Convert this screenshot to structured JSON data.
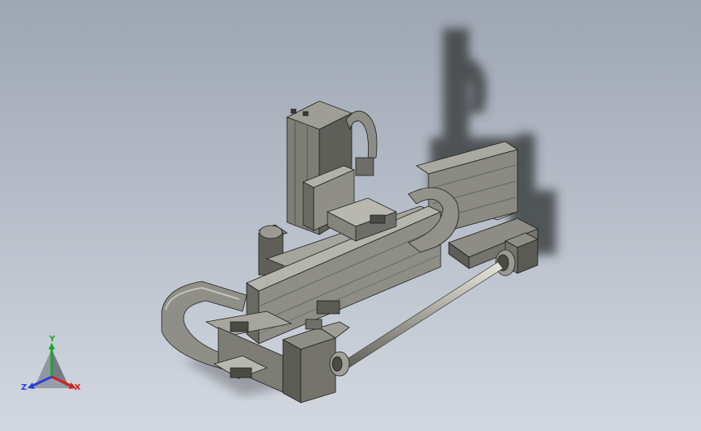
{
  "viewport": {
    "background_top": "#9ea6b3",
    "background_bottom": "#d3d8e0"
  },
  "model": {
    "body_color": "#8d8d86",
    "dark_color": "#3c3c38",
    "light_color": "#c9c9c1",
    "edge_color": "#1e1e1c",
    "shadow_color": "#2f3033"
  },
  "triad": {
    "x_label": "X",
    "y_label": "Y",
    "z_label": "Z",
    "x_color": "#d42020",
    "y_color": "#19a62a",
    "z_color": "#2a3fd8",
    "x_icon": "axis-arrow-icon",
    "y_icon": "axis-arrow-icon",
    "z_icon": "axis-arrow-icon"
  }
}
